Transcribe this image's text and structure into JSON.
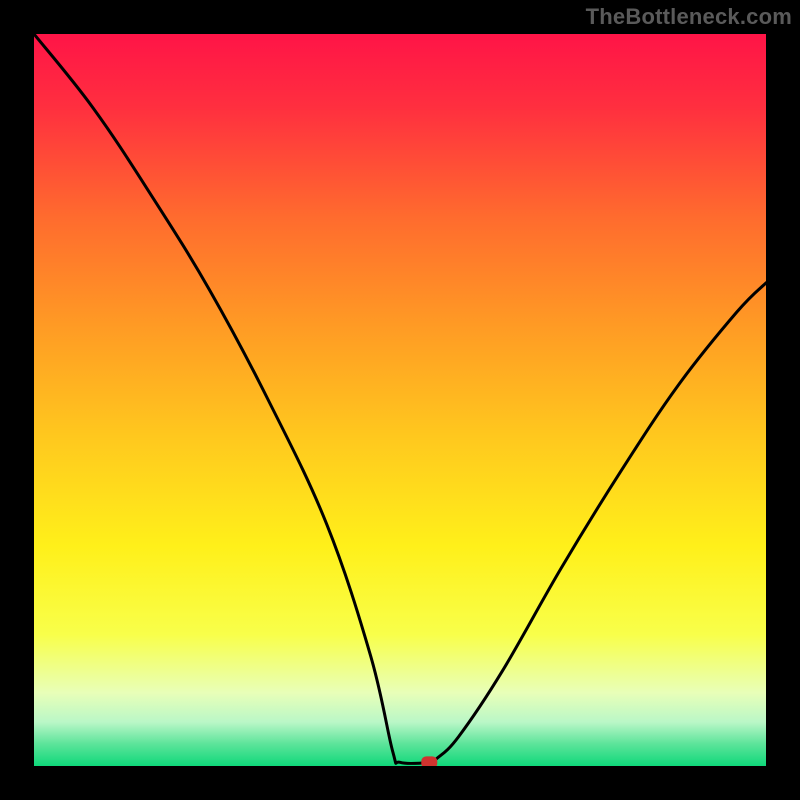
{
  "watermark": "TheBottleneck.com",
  "chart_data": {
    "type": "line",
    "title": "",
    "xlabel": "",
    "ylabel": "",
    "xlim": [
      0,
      100
    ],
    "ylim": [
      0,
      100
    ],
    "curve": [
      {
        "x": 0,
        "y": 100
      },
      {
        "x": 8,
        "y": 90
      },
      {
        "x": 16,
        "y": 78
      },
      {
        "x": 24,
        "y": 65
      },
      {
        "x": 32,
        "y": 50
      },
      {
        "x": 40,
        "y": 33
      },
      {
        "x": 46,
        "y": 15
      },
      {
        "x": 49,
        "y": 2
      },
      {
        "x": 50,
        "y": 0.5
      },
      {
        "x": 54,
        "y": 0.5
      },
      {
        "x": 55,
        "y": 1
      },
      {
        "x": 58,
        "y": 4
      },
      {
        "x": 64,
        "y": 13
      },
      {
        "x": 72,
        "y": 27
      },
      {
        "x": 80,
        "y": 40
      },
      {
        "x": 88,
        "y": 52
      },
      {
        "x": 96,
        "y": 62
      },
      {
        "x": 100,
        "y": 66
      }
    ],
    "marker": {
      "x": 54,
      "y": 0.5
    },
    "gradient_stops": [
      {
        "offset": 0.0,
        "color": "#ff1447"
      },
      {
        "offset": 0.1,
        "color": "#ff2f3f"
      },
      {
        "offset": 0.25,
        "color": "#ff6b2e"
      },
      {
        "offset": 0.4,
        "color": "#ff9b24"
      },
      {
        "offset": 0.55,
        "color": "#ffc81e"
      },
      {
        "offset": 0.7,
        "color": "#fff01a"
      },
      {
        "offset": 0.82,
        "color": "#f8ff4a"
      },
      {
        "offset": 0.9,
        "color": "#e8ffb8"
      },
      {
        "offset": 0.94,
        "color": "#baf7c7"
      },
      {
        "offset": 0.97,
        "color": "#5ce49a"
      },
      {
        "offset": 1.0,
        "color": "#0fd87a"
      }
    ]
  }
}
